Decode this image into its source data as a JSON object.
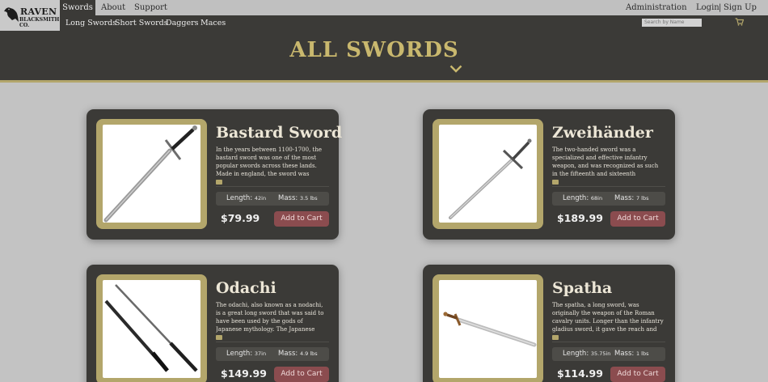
{
  "brand": {
    "line1": "RAVEN",
    "line2": "BLACKSMITH CO."
  },
  "topnav": {
    "items": [
      "Swords",
      "About",
      "Support"
    ],
    "admin": "Administration",
    "login": "Login",
    "separator": "|",
    "signup": "Sign Up"
  },
  "subnav": {
    "items": [
      "Long Swords",
      "Short Swords",
      "Daggers",
      "Maces"
    ],
    "search_placeholder": "Search by Name"
  },
  "hero": {
    "title": "ALL SWORDS"
  },
  "products": [
    {
      "name": "Bastard Sword",
      "description": "In the years between 1100-1700, the bastard sword was one of the most popular swords across these lands. Made in england, the sword was mostly",
      "length_label": "Length:",
      "length_value": "42in",
      "mass_label": "Mass:",
      "mass_value": "3.5 lbs",
      "price": "$79.99",
      "cta": "Add to Cart"
    },
    {
      "name": "Zweihänder",
      "description": "The two-handed sword was a specialized and effective infantry weapon, and was recognized as such in the fifteenth and sixteenth centuries.",
      "length_label": "Length:",
      "length_value": "68in",
      "mass_label": "Mass:",
      "mass_value": "7 lbs",
      "price": "$189.99",
      "cta": "Add to Cart"
    },
    {
      "name": "Odachi",
      "description": "The odachi, also known as a nodachi, is a great long sword that was said to have been used by the gods of Japanese mythology. The Japanese sword was",
      "length_label": "Length:",
      "length_value": "37in",
      "mass_label": "Mass:",
      "mass_value": "4.9 lbs",
      "price": "$149.99",
      "cta": "Add to Cart"
    },
    {
      "name": "Spatha",
      "description": "The spatha, a long sword, was originally the weapon of the Roman cavalry units. Longer than the infantry gladius sword, it gave the reach and cutting power",
      "length_label": "Length:",
      "length_value": "35.75in",
      "mass_label": "Mass:",
      "mass_value": "1 lbs",
      "price": "$114.99",
      "cta": "Add to Cart"
    }
  ],
  "colors": {
    "dark": "#3b3a37",
    "gold": "#b3a66b",
    "button": "#8b4c4f",
    "background": "#c3c3c3"
  }
}
